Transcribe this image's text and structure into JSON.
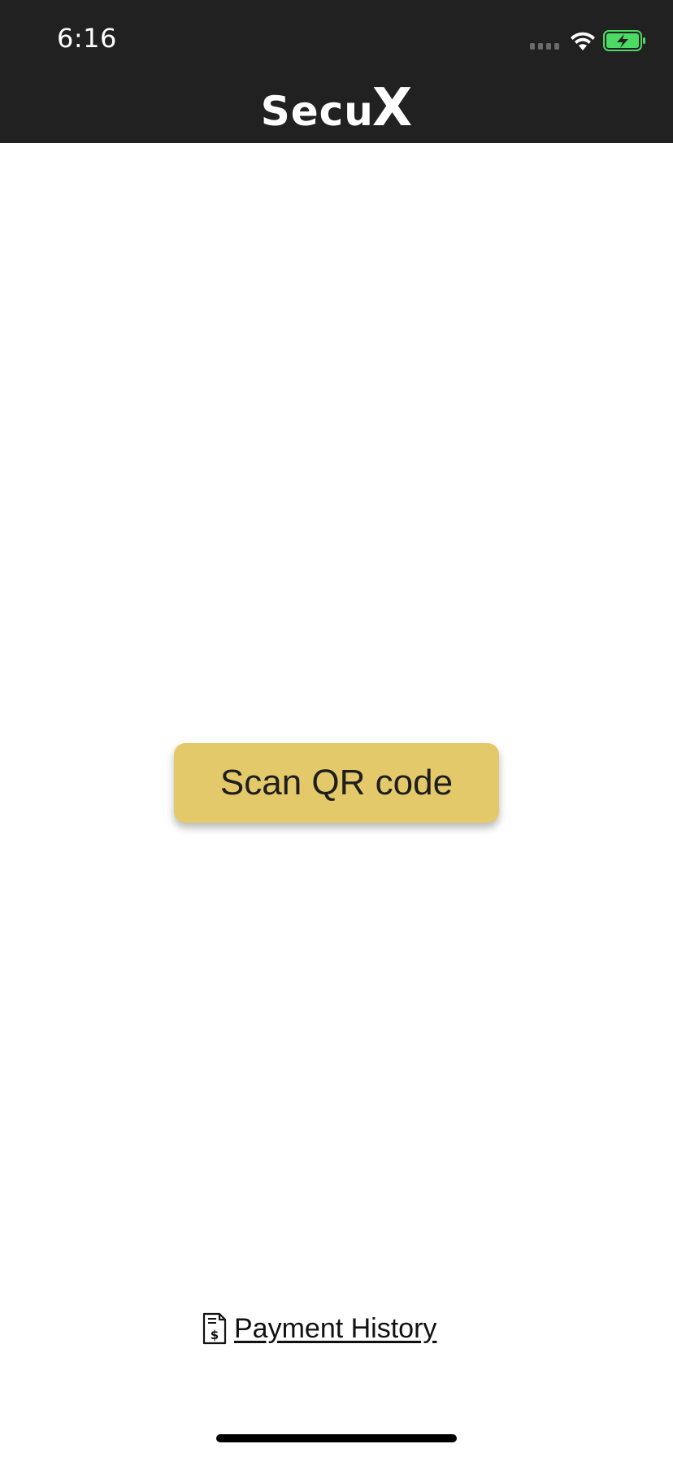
{
  "status_bar": {
    "time": "6:16",
    "signal_icon": "signal-bars-icon",
    "wifi_icon": "wifi-icon",
    "battery_icon": "battery-charging-icon",
    "battery_color": "#4cd964"
  },
  "header": {
    "brand_secu": "Secu",
    "brand_x": "X",
    "background_color": "#212121"
  },
  "main": {
    "scan_button_label": "Scan QR code",
    "scan_button_color": "#e3c96a"
  },
  "footer": {
    "history_icon": "receipt-dollar-icon",
    "history_label": "Payment History"
  }
}
